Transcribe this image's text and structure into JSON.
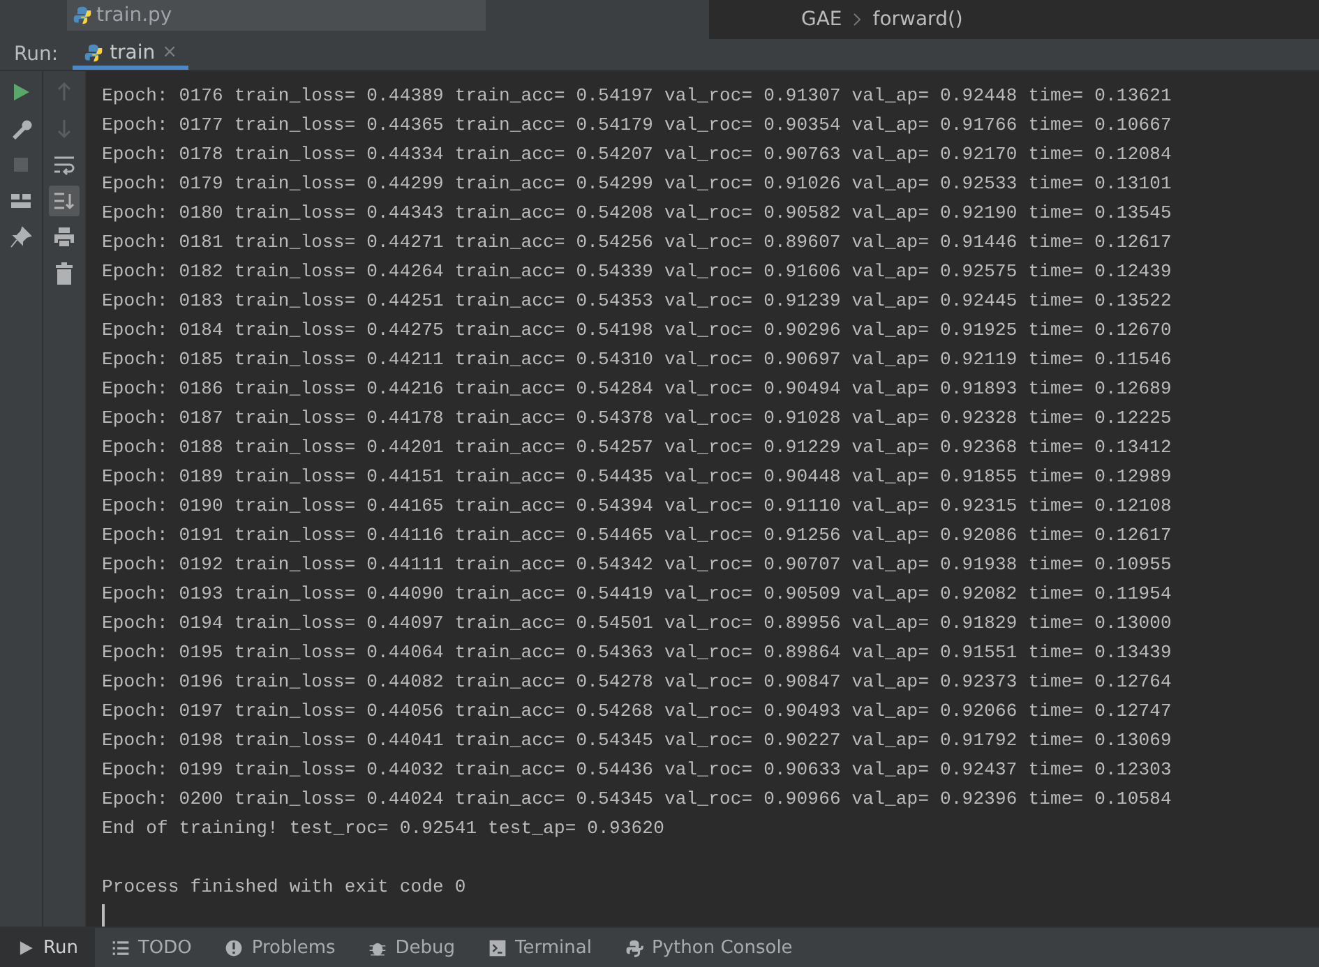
{
  "editor_tab": {
    "label": "train.py"
  },
  "breadcrumb": [
    "GAE",
    "forward()"
  ],
  "run_bar": {
    "label": "Run:",
    "tab": {
      "label": "train",
      "close": "×",
      "selected": true
    }
  },
  "left_tools": [
    {
      "kind": "run",
      "disabled": false
    },
    {
      "kind": "wrench",
      "disabled": false
    },
    {
      "kind": "stop",
      "disabled": true
    },
    {
      "kind": "layout",
      "disabled": false
    },
    {
      "kind": "pin",
      "disabled": false
    }
  ],
  "right_tools": [
    {
      "kind": "up",
      "disabled": true,
      "selected": false
    },
    {
      "kind": "down",
      "disabled": true,
      "selected": false
    },
    {
      "kind": "wrap",
      "disabled": false,
      "selected": false
    },
    {
      "kind": "scroll-end",
      "disabled": false,
      "selected": true
    },
    {
      "kind": "print",
      "disabled": false,
      "selected": false
    },
    {
      "kind": "trash",
      "disabled": false,
      "selected": false
    }
  ],
  "console_lines": [
    "Epoch: 0176 train_loss= 0.44389 train_acc= 0.54197 val_roc= 0.91307 val_ap= 0.92448 time= 0.13621",
    "Epoch: 0177 train_loss= 0.44365 train_acc= 0.54179 val_roc= 0.90354 val_ap= 0.91766 time= 0.10667",
    "Epoch: 0178 train_loss= 0.44334 train_acc= 0.54207 val_roc= 0.90763 val_ap= 0.92170 time= 0.12084",
    "Epoch: 0179 train_loss= 0.44299 train_acc= 0.54299 val_roc= 0.91026 val_ap= 0.92533 time= 0.13101",
    "Epoch: 0180 train_loss= 0.44343 train_acc= 0.54208 val_roc= 0.90582 val_ap= 0.92190 time= 0.13545",
    "Epoch: 0181 train_loss= 0.44271 train_acc= 0.54256 val_roc= 0.89607 val_ap= 0.91446 time= 0.12617",
    "Epoch: 0182 train_loss= 0.44264 train_acc= 0.54339 val_roc= 0.91606 val_ap= 0.92575 time= 0.12439",
    "Epoch: 0183 train_loss= 0.44251 train_acc= 0.54353 val_roc= 0.91239 val_ap= 0.92445 time= 0.13522",
    "Epoch: 0184 train_loss= 0.44275 train_acc= 0.54198 val_roc= 0.90296 val_ap= 0.91925 time= 0.12670",
    "Epoch: 0185 train_loss= 0.44211 train_acc= 0.54310 val_roc= 0.90697 val_ap= 0.92119 time= 0.11546",
    "Epoch: 0186 train_loss= 0.44216 train_acc= 0.54284 val_roc= 0.90494 val_ap= 0.91893 time= 0.12689",
    "Epoch: 0187 train_loss= 0.44178 train_acc= 0.54378 val_roc= 0.91028 val_ap= 0.92328 time= 0.12225",
    "Epoch: 0188 train_loss= 0.44201 train_acc= 0.54257 val_roc= 0.91229 val_ap= 0.92368 time= 0.13412",
    "Epoch: 0189 train_loss= 0.44151 train_acc= 0.54435 val_roc= 0.90448 val_ap= 0.91855 time= 0.12989",
    "Epoch: 0190 train_loss= 0.44165 train_acc= 0.54394 val_roc= 0.91110 val_ap= 0.92315 time= 0.12108",
    "Epoch: 0191 train_loss= 0.44116 train_acc= 0.54465 val_roc= 0.91256 val_ap= 0.92086 time= 0.12617",
    "Epoch: 0192 train_loss= 0.44111 train_acc= 0.54342 val_roc= 0.90707 val_ap= 0.91938 time= 0.10955",
    "Epoch: 0193 train_loss= 0.44090 train_acc= 0.54419 val_roc= 0.90509 val_ap= 0.92082 time= 0.11954",
    "Epoch: 0194 train_loss= 0.44097 train_acc= 0.54501 val_roc= 0.89956 val_ap= 0.91829 time= 0.13000",
    "Epoch: 0195 train_loss= 0.44064 train_acc= 0.54363 val_roc= 0.89864 val_ap= 0.91551 time= 0.13439",
    "Epoch: 0196 train_loss= 0.44082 train_acc= 0.54278 val_roc= 0.90847 val_ap= 0.92373 time= 0.12764",
    "Epoch: 0197 train_loss= 0.44056 train_acc= 0.54268 val_roc= 0.90493 val_ap= 0.92066 time= 0.12747",
    "Epoch: 0198 train_loss= 0.44041 train_acc= 0.54345 val_roc= 0.90227 val_ap= 0.91792 time= 0.13069",
    "Epoch: 0199 train_loss= 0.44032 train_acc= 0.54436 val_roc= 0.90633 val_ap= 0.92437 time= 0.12303",
    "Epoch: 0200 train_loss= 0.44024 train_acc= 0.54345 val_roc= 0.90966 val_ap= 0.92396 time= 0.10584",
    "End of training! test_roc= 0.92541 test_ap= 0.93620"
  ],
  "exit_message": "Process finished with exit code 0",
  "bottom_tabs": [
    {
      "kind": "run",
      "label": "Run",
      "selected": true
    },
    {
      "kind": "list",
      "label": "TODO",
      "selected": false
    },
    {
      "kind": "problems",
      "label": "Problems",
      "selected": false
    },
    {
      "kind": "bug",
      "label": "Debug",
      "selected": false
    },
    {
      "kind": "terminal",
      "label": "Terminal",
      "selected": false
    },
    {
      "kind": "python",
      "label": "Python Console",
      "selected": false
    }
  ]
}
